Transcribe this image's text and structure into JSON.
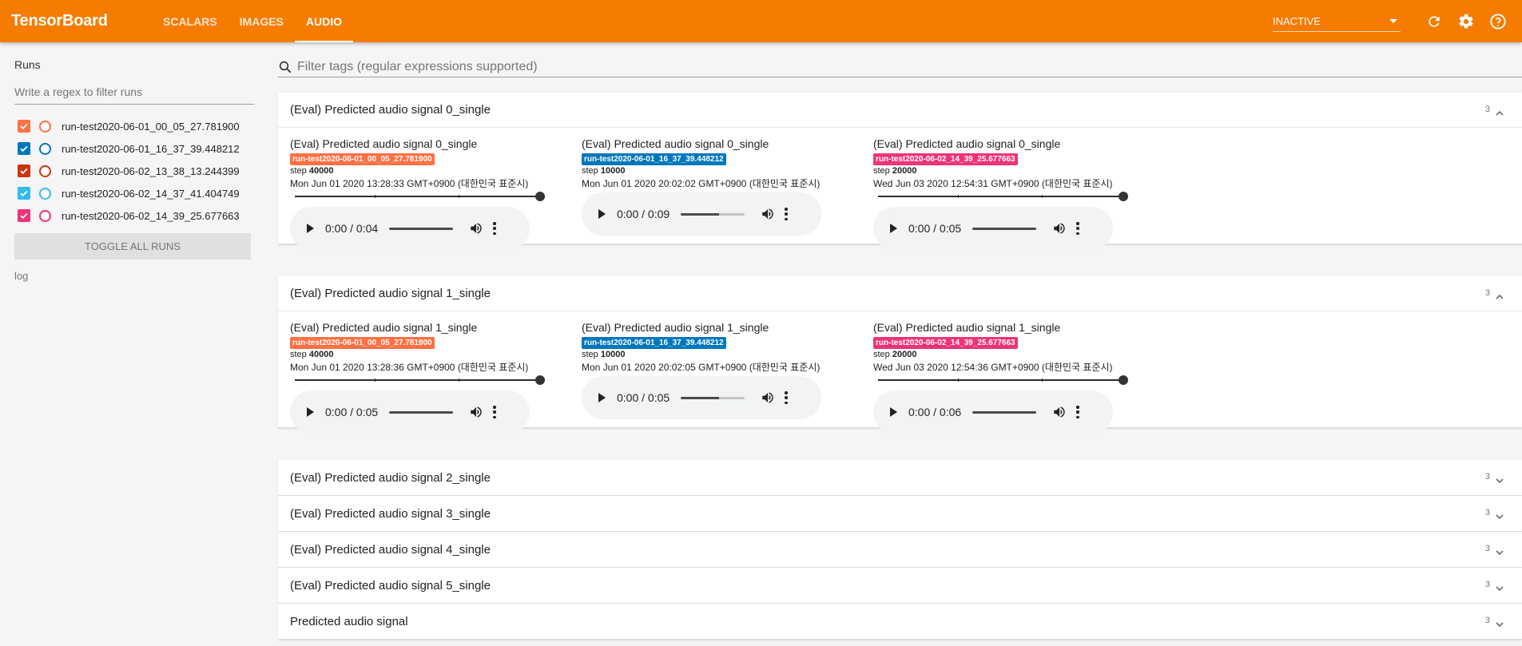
{
  "app": {
    "title": "TensorBoard"
  },
  "nav": {
    "tabs": [
      {
        "label": "SCALARS"
      },
      {
        "label": "IMAGES"
      },
      {
        "label": "AUDIO"
      }
    ]
  },
  "header": {
    "reload_select": "INACTIVE",
    "icons": [
      "refresh-icon",
      "settings-icon",
      "help-icon"
    ]
  },
  "sidebar": {
    "title": "Runs",
    "filter_placeholder": "Write a regex to filter runs",
    "runs": [
      {
        "name": "run-test2020-06-01_00_05_27.781900",
        "color": "#ff7043",
        "checked": true
      },
      {
        "name": "run-test2020-06-01_16_37_39.448212",
        "color": "#0077bb",
        "checked": true
      },
      {
        "name": "run-test2020-06-02_13_38_13.244399",
        "color": "#cc3311",
        "checked": true
      },
      {
        "name": "run-test2020-06-02_14_37_41.404749",
        "color": "#33bbee",
        "checked": true
      },
      {
        "name": "run-test2020-06-02_14_39_25.677663",
        "color": "#ee3377",
        "checked": true
      }
    ],
    "toggle_label": "TOGGLE ALL RUNS",
    "logdir": "log"
  },
  "main": {
    "tag_filter_placeholder": "Filter tags (regular expressions supported)",
    "panes": [
      {
        "title": "(Eval) Predicted audio signal 0_single",
        "count": "3",
        "expanded": true,
        "cards": [
          {
            "title": "(Eval) Predicted audio signal 0_single",
            "run": "run-test2020-06-01_00_05_27.781900",
            "run_color": "#ff7043",
            "step_label": "step",
            "step": "40000",
            "time": "Mon Jun 01 2020 13:28:33 GMT+0900 (대한민국 표준시)",
            "has_slider": true,
            "player_time": "0:00 / 0:04",
            "progress": 0
          },
          {
            "title": "(Eval) Predicted audio signal 0_single",
            "run": "run-test2020-06-01_16_37_39.448212",
            "run_color": "#0077bb",
            "step_label": "step",
            "step": "10000",
            "time": "Mon Jun 01 2020 20:02:02 GMT+0900 (대한민국 표준시)",
            "has_slider": false,
            "player_time": "0:00 / 0:09",
            "progress": 0
          },
          {
            "title": "(Eval) Predicted audio signal 0_single",
            "run": "run-test2020-06-02_14_39_25.677663",
            "run_color": "#ee3377",
            "step_label": "step",
            "step": "20000",
            "time": "Wed Jun 03 2020 12:54:31 GMT+0900 (대한민국 표준시)",
            "has_slider": true,
            "player_time": "0:00 / 0:05",
            "progress": 0
          }
        ]
      },
      {
        "title": "(Eval) Predicted audio signal 1_single",
        "count": "3",
        "expanded": true,
        "cards": [
          {
            "title": "(Eval) Predicted audio signal 1_single",
            "run": "run-test2020-06-01_00_05_27.781900",
            "run_color": "#ff7043",
            "step_label": "step",
            "step": "40000",
            "time": "Mon Jun 01 2020 13:28:36 GMT+0900 (대한민국 표준시)",
            "has_slider": true,
            "player_time": "0:00 / 0:05",
            "progress": 0
          },
          {
            "title": "(Eval) Predicted audio signal 1_single",
            "run": "run-test2020-06-01_16_37_39.448212",
            "run_color": "#0077bb",
            "step_label": "step",
            "step": "10000",
            "time": "Mon Jun 01 2020 20:02:05 GMT+0900 (대한민국 표준시)",
            "has_slider": false,
            "player_time": "0:00 / 0:05",
            "progress": 0
          },
          {
            "title": "(Eval) Predicted audio signal 1_single",
            "run": "run-test2020-06-02_14_39_25.677663",
            "run_color": "#ee3377",
            "step_label": "step",
            "step": "20000",
            "time": "Wed Jun 03 2020 12:54:36 GMT+0900 (대한민국 표준시)",
            "has_slider": true,
            "player_time": "0:00 / 0:06",
            "progress": 0
          }
        ]
      },
      {
        "title": "(Eval) Predicted audio signal 2_single",
        "count": "3",
        "expanded": false
      },
      {
        "title": "(Eval) Predicted audio signal 3_single",
        "count": "3",
        "expanded": false
      },
      {
        "title": "(Eval) Predicted audio signal 4_single",
        "count": "3",
        "expanded": false
      },
      {
        "title": "(Eval) Predicted audio signal 5_single",
        "count": "3",
        "expanded": false
      },
      {
        "title": "Predicted audio signal",
        "count": "3",
        "expanded": false
      }
    ]
  }
}
